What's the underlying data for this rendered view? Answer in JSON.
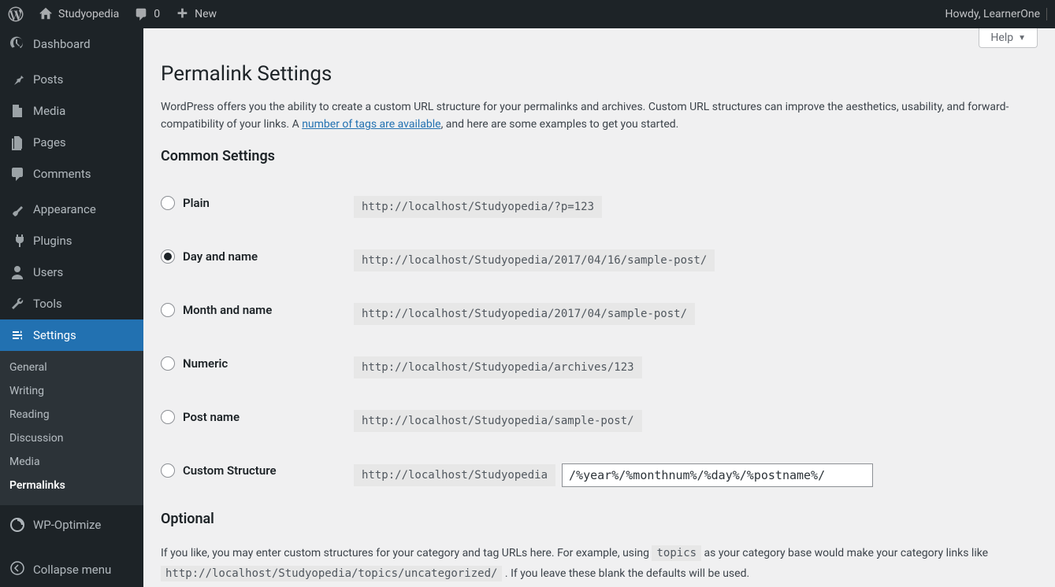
{
  "toolbar": {
    "site_name": "Studyopedia",
    "comment_count": "0",
    "new_label": "New",
    "howdy": "Howdy, LearnerOne"
  },
  "sidebar": {
    "items": [
      {
        "label": "Dashboard"
      },
      {
        "label": "Posts"
      },
      {
        "label": "Media"
      },
      {
        "label": "Pages"
      },
      {
        "label": "Comments"
      },
      {
        "label": "Appearance"
      },
      {
        "label": "Plugins"
      },
      {
        "label": "Users"
      },
      {
        "label": "Tools"
      },
      {
        "label": "Settings"
      },
      {
        "label": "WP-Optimize"
      }
    ],
    "submenu": [
      {
        "label": "General"
      },
      {
        "label": "Writing"
      },
      {
        "label": "Reading"
      },
      {
        "label": "Discussion"
      },
      {
        "label": "Media"
      },
      {
        "label": "Permalinks"
      }
    ],
    "collapse_label": "Collapse menu"
  },
  "help_label": "Help",
  "page": {
    "title": "Permalink Settings",
    "intro_part1": "WordPress offers you the ability to create a custom URL structure for your permalinks and archives. Custom URL structures can improve the aesthetics, usability, and forward-compatibility of your links. A ",
    "intro_link": "number of tags are available",
    "intro_part2": ", and here are some examples to get you started.",
    "common_heading": "Common Settings",
    "options": [
      {
        "label": "Plain",
        "example": "http://localhost/Studyopedia/?p=123"
      },
      {
        "label": "Day and name",
        "example": "http://localhost/Studyopedia/2017/04/16/sample-post/"
      },
      {
        "label": "Month and name",
        "example": "http://localhost/Studyopedia/2017/04/sample-post/"
      },
      {
        "label": "Numeric",
        "example": "http://localhost/Studyopedia/archives/123"
      },
      {
        "label": "Post name",
        "example": "http://localhost/Studyopedia/sample-post/"
      },
      {
        "label": "Custom Structure",
        "example": "http://localhost/Studyopedia"
      }
    ],
    "custom_value": "/%year%/%monthnum%/%day%/%postname%/",
    "optional_heading": "Optional",
    "optional_text1": "If you like, you may enter custom structures for your category and tag URLs here. For example, using ",
    "optional_code1": "topics",
    "optional_text2": " as your category base would make your category links like ",
    "optional_code2": "http://localhost/Studyopedia/topics/uncategorized/",
    "optional_text3": " . If you leave these blank the defaults will be used."
  }
}
